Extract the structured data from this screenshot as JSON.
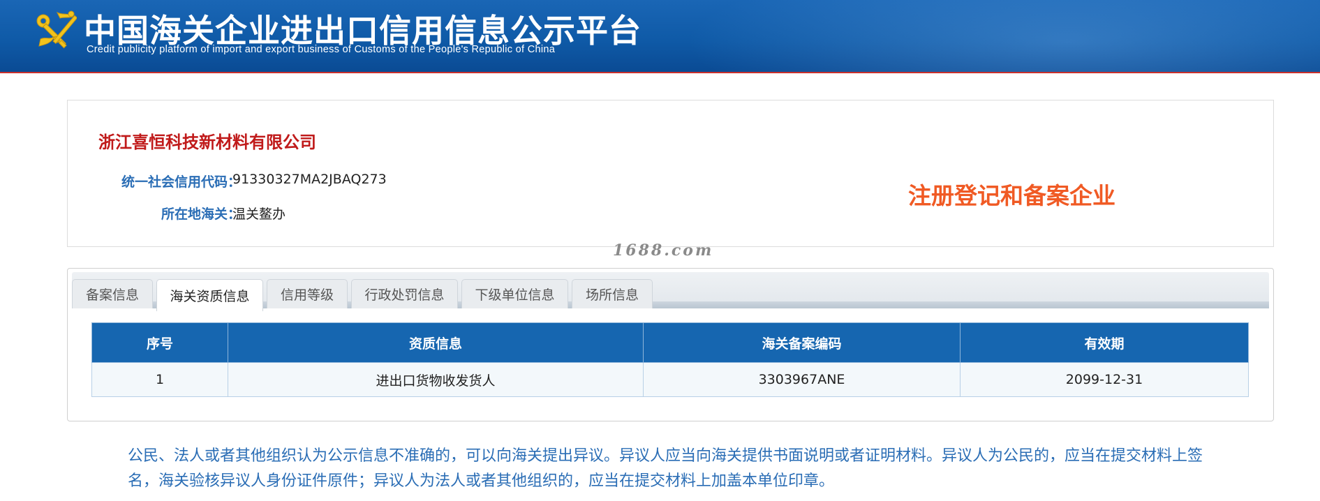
{
  "header": {
    "title": "中国海关企业进出口信用信息公示平台",
    "subtitle": "Credit publicity platform of import and export business of Customs of the People's Republic of China"
  },
  "company": {
    "name": "浙江喜恒科技新材料有限公司",
    "credit_code_label": "统一社会信用代码：",
    "credit_code": "91330327MA2JBAQ273",
    "customs_label": "所在地海关：",
    "customs": "温关鳌办",
    "status_stamp": "注册登记和备案企业"
  },
  "watermark": "1688.com",
  "tabs": [
    {
      "label": "备案信息",
      "active": false
    },
    {
      "label": "海关资质信息",
      "active": true
    },
    {
      "label": "信用等级",
      "active": false
    },
    {
      "label": "行政处罚信息",
      "active": false
    },
    {
      "label": "下级单位信息",
      "active": false
    },
    {
      "label": "场所信息",
      "active": false
    }
  ],
  "table": {
    "headers": [
      "序号",
      "资质信息",
      "海关备案编码",
      "有效期"
    ],
    "rows": [
      [
        "1",
        "进出口货物收发货人",
        "3303967ANE",
        "2099-12-31"
      ]
    ]
  },
  "notice": "公民、法人或者其他组织认为公示信息不准确的，可以向海关提出异议。异议人应当向海关提供书面说明或者证明材料。异议人为公民的，应当在提交材料上签名，海关验核异议人身份证件原件；异议人为法人或者其他组织的，应当在提交材料上加盖本单位印章。",
  "colors": {
    "header_blue": "#0f5aa7",
    "accent_red": "#c9302c",
    "company_red": "#c01a1a",
    "label_blue": "#2a6db5",
    "stamp_orange": "#f05a24",
    "table_head": "#1666b0"
  },
  "icons": {
    "logo": "customs-emblem-icon"
  }
}
